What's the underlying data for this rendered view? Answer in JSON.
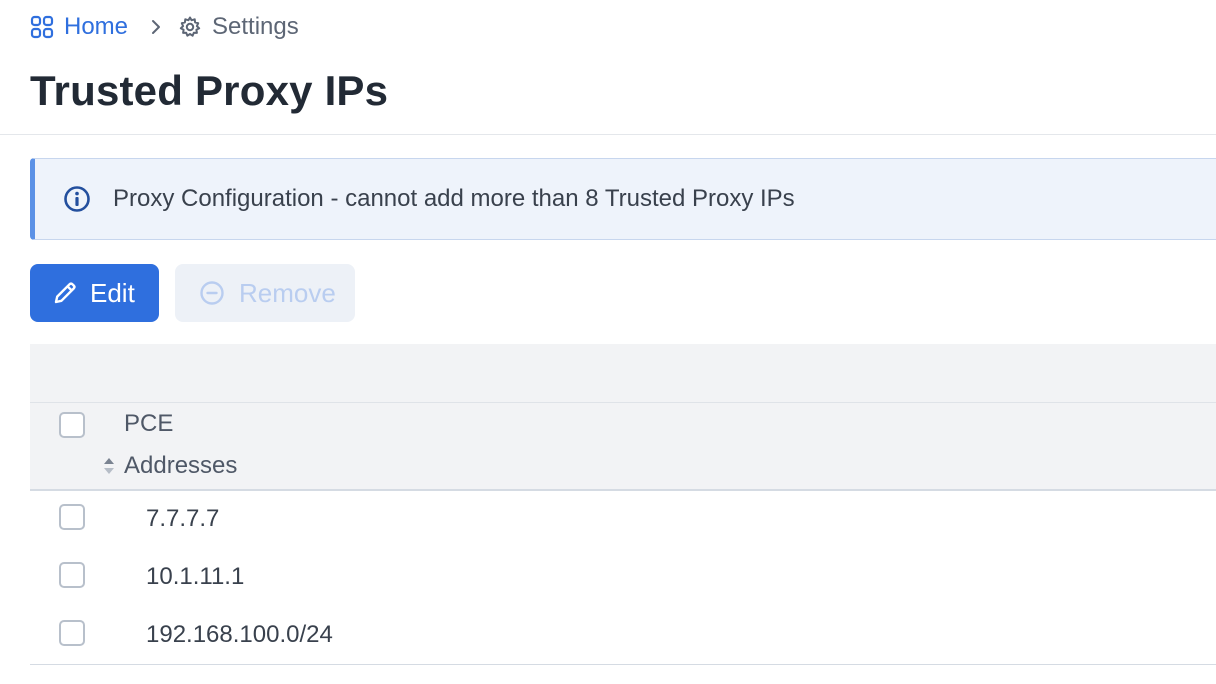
{
  "breadcrumb": {
    "home_label": "Home",
    "separator_icon": "chevron-right-icon",
    "settings_label": "Settings"
  },
  "page": {
    "title": "Trusted Proxy IPs"
  },
  "banner": {
    "icon": "info-circle-icon",
    "message": "Proxy Configuration - cannot add more than 8 Trusted Proxy IPs"
  },
  "toolbar": {
    "edit_label": "Edit",
    "edit_icon": "pencil-icon",
    "remove_label": "Remove",
    "remove_icon": "minus-circle-icon",
    "remove_disabled": true
  },
  "table": {
    "column_title": "PCE",
    "column_subtitle": "Addresses",
    "sort_icon": "sort-icon",
    "rows": [
      {
        "address": "7.7.7.7"
      },
      {
        "address": "10.1.11.1"
      },
      {
        "address": "192.168.100.0/24"
      }
    ]
  },
  "colors": {
    "accent": "#2f6fde",
    "banner_background": "#eef3fb",
    "banner_border": "#5b91e6",
    "disabled_text": "#b9cdf0",
    "header_background": "#f2f3f5"
  }
}
